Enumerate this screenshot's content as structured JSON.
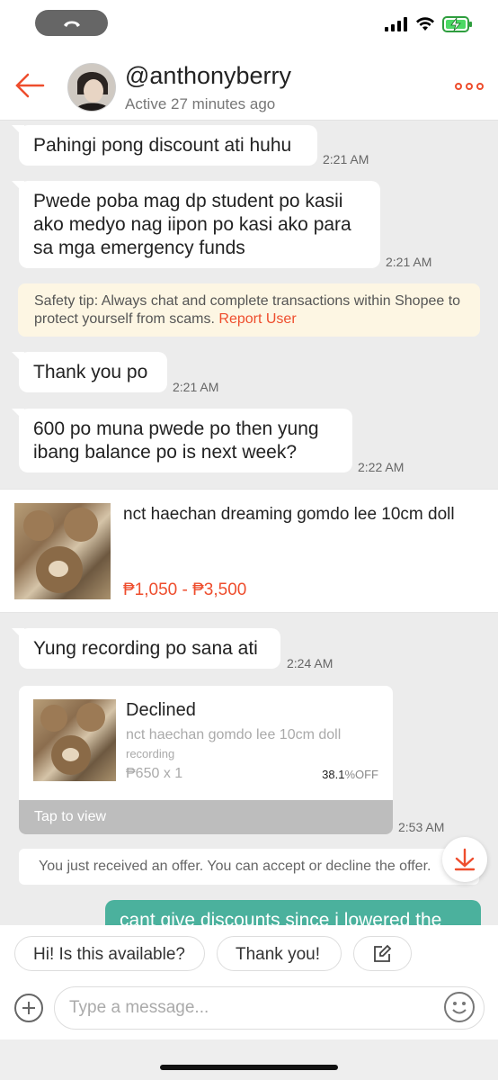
{
  "header": {
    "username": "@anthonyberry",
    "active_status": "Active 27 minutes ago"
  },
  "messages": [
    {
      "text": "Pahingi pong discount ati huhu",
      "time": "2:21 AM"
    },
    {
      "text": "Pwede poba mag dp student po kasii ako medyo nag iipon po kasi ako para sa mga emergency funds",
      "time": "2:21 AM"
    },
    {
      "text": "Thank you po",
      "time": "2:21 AM"
    },
    {
      "text": "600 po muna pwede po then yung ibang balance po is next week?",
      "time": "2:22 AM"
    },
    {
      "text": "Yung recording po sana ati",
      "time": "2:24 AM"
    }
  ],
  "safety_tip": {
    "text": "Safety tip: Always chat and complete transactions within Shopee to protect yourself from scams.",
    "link": "Report User"
  },
  "product": {
    "title": "nct haechan dreaming gomdo lee 10cm doll",
    "price": "₱1,050 - ₱3,500"
  },
  "offer": {
    "status": "Declined",
    "name": "nct haechan gomdo lee 10cm doll",
    "variant": "recording",
    "qty": "₱650 x 1",
    "discount": "38.1",
    "discount_suffix": "%OFF",
    "tap_label": "Tap to view",
    "time": "2:53 AM"
  },
  "notice": "You just received an offer. You can accept or decline the offer.",
  "sent_message": "cant give discounts since i lowered the",
  "quick_replies": [
    "Hi! Is this available?",
    "Thank you!"
  ],
  "input": {
    "placeholder": "Type a message..."
  },
  "colors": {
    "accent": "#ee4d2d",
    "sent_bubble": "#4bb19d",
    "safety_bg": "#fdf6e3"
  },
  "icons": [
    "back-arrow-icon",
    "more-icon",
    "scroll-down-icon",
    "edit-icon",
    "plus-icon",
    "emoji-icon"
  ]
}
